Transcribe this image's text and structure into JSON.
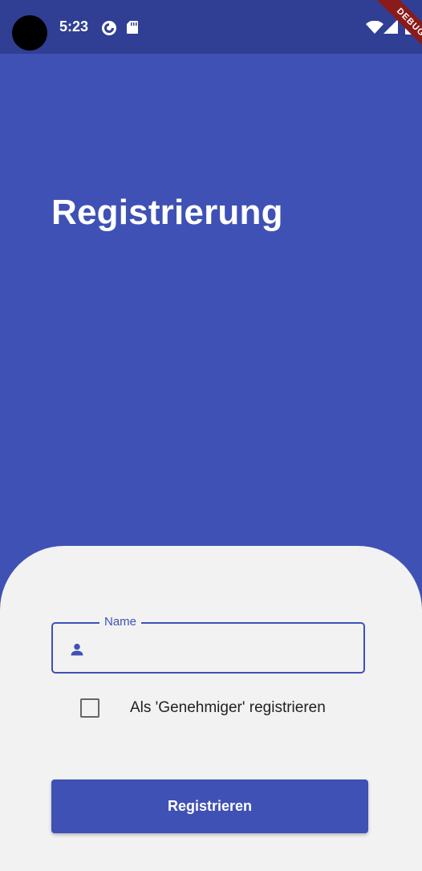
{
  "status_bar": {
    "time": "5:23"
  },
  "debug_banner": "DEBUG",
  "header": {
    "title": "Registrierung"
  },
  "form": {
    "name_label": "Name",
    "name_value": "",
    "approver_checkbox_label": "Als 'Genehmiger' registrieren",
    "approver_checked": false,
    "submit_label": "Registrieren"
  },
  "colors": {
    "primary": "#3f51b5",
    "status_bar": "#303f94",
    "panel": "#f2f2f2",
    "debug_ribbon": "#8b1a1a"
  },
  "icons": {
    "status": [
      "pocket-casts-icon",
      "sd-card-icon",
      "wifi-icon",
      "signal-icon",
      "battery-icon"
    ],
    "name_field": "person-icon"
  }
}
